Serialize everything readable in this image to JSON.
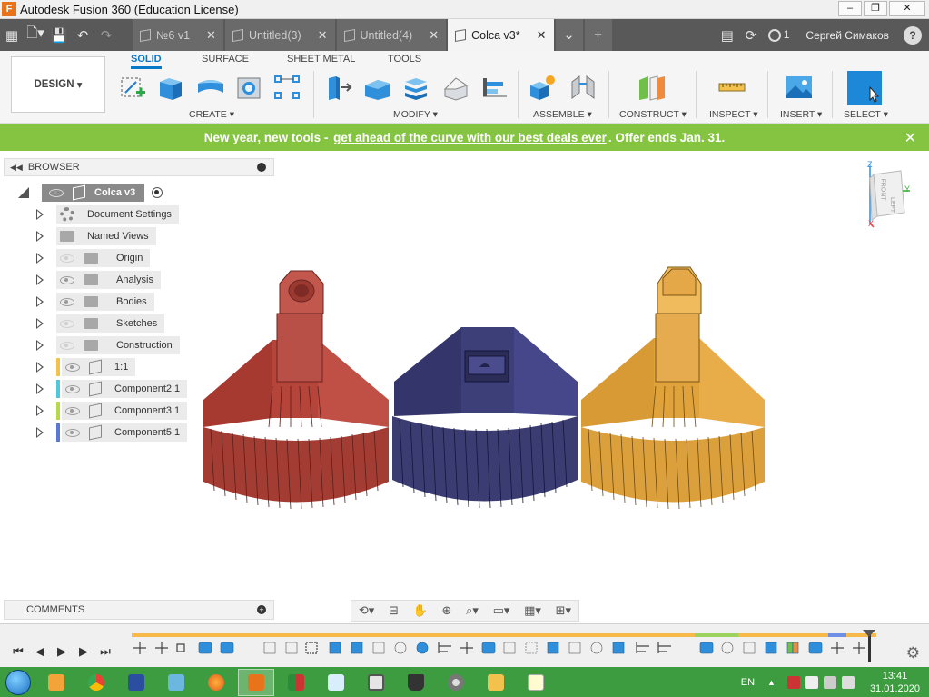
{
  "window": {
    "title": "Autodesk Fusion 360 (Education License)",
    "app_icon": "F"
  },
  "tabs": [
    {
      "label": "№6 v1",
      "active": false
    },
    {
      "label": "Untitled(3)",
      "active": false
    },
    {
      "label": "Untitled(4)",
      "active": false
    },
    {
      "label": "Colca v3*",
      "active": true
    }
  ],
  "header": {
    "job_count": "1",
    "user": "Сергей Симаков",
    "help": "?"
  },
  "toolbar": {
    "design_label": "DESIGN",
    "workspace_tabs": [
      "SOLID",
      "SURFACE",
      "SHEET METAL",
      "TOOLS"
    ],
    "groups": {
      "create": "CREATE",
      "modify": "MODIFY",
      "assemble": "ASSEMBLE",
      "construct": "CONSTRUCT",
      "inspect": "INSPECT",
      "insert": "INSERT",
      "select": "SELECT"
    }
  },
  "banner": {
    "prefix": "New year, new tools - ",
    "link": "get ahead of the curve with our best deals ever",
    "suffix": ". Offer ends Jan. 31.",
    "close": "✕"
  },
  "browser": {
    "title": "BROWSER",
    "root": "Colca v3",
    "items": [
      {
        "label": "Document Settings",
        "kind": "gear"
      },
      {
        "label": "Named Views",
        "kind": "folder"
      },
      {
        "label": "Origin",
        "kind": "folder"
      },
      {
        "label": "Analysis",
        "kind": "folder"
      },
      {
        "label": "Bodies",
        "kind": "folder"
      },
      {
        "label": "Sketches",
        "kind": "folder"
      },
      {
        "label": "Construction",
        "kind": "folder"
      },
      {
        "label": "1:1",
        "kind": "component",
        "color": "#f2c14e"
      },
      {
        "label": "Component2:1",
        "kind": "component",
        "color": "#52c7d9"
      },
      {
        "label": "Component3:1",
        "kind": "component",
        "color": "#b4d94a"
      },
      {
        "label": "Component5:1",
        "kind": "component",
        "color": "#5a78d6"
      }
    ]
  },
  "comments": {
    "title": "COMMENTS",
    "add": "+"
  },
  "viewcube": {
    "face": "FRONT",
    "side": "LEFT",
    "z_axis": "Z",
    "y_axis": "Y",
    "x_axis": "X"
  },
  "models": [
    {
      "name": "red-part",
      "color": "#b5443a"
    },
    {
      "name": "blue-part",
      "color": "#3d3f78"
    },
    {
      "name": "orange-part",
      "color": "#e0a23a"
    }
  ],
  "taskbar": {
    "lang": "EN",
    "time": "13:41",
    "date": "31.01.2020"
  }
}
